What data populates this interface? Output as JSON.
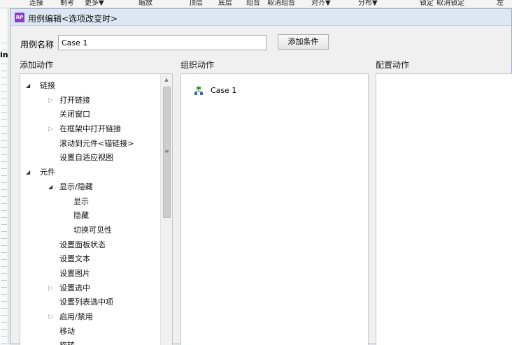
{
  "app_toolbar": {
    "items": [
      "连接",
      "制考",
      "更多▼",
      "缩放",
      "顶层",
      "底层",
      "组合",
      "取消组合",
      "对齐▼",
      "分布▼",
      "锁定",
      "取消锁定",
      "左"
    ]
  },
  "app_left": {
    "label": "in"
  },
  "dialog": {
    "logo": "RP",
    "title": "用例编辑<选项改变时>",
    "name_label": "用例名称",
    "name_value": "Case 1",
    "add_condition_label": "添加条件",
    "add_action_header": "添加动作",
    "organize_header": "组织动作",
    "config_header": "配置动作",
    "organize_case_label": "Case 1"
  },
  "tree": [
    {
      "label": "链接",
      "level": 0,
      "arrow": "open"
    },
    {
      "label": "打开链接",
      "level": 1,
      "arrow": "closed"
    },
    {
      "label": "关闭窗口",
      "level": 1,
      "arrow": "none"
    },
    {
      "label": "在框架中打开链接",
      "level": 1,
      "arrow": "closed"
    },
    {
      "label": "滚动到元件<锚链接>",
      "level": 1,
      "arrow": "none"
    },
    {
      "label": "设置自适应视图",
      "level": 1,
      "arrow": "none"
    },
    {
      "label": "元件",
      "level": 0,
      "arrow": "open"
    },
    {
      "label": "显示/隐藏",
      "level": 1,
      "arrow": "open"
    },
    {
      "label": "显示",
      "level": 2,
      "arrow": "none"
    },
    {
      "label": "隐藏",
      "level": 2,
      "arrow": "none"
    },
    {
      "label": "切换可见性",
      "level": 2,
      "arrow": "none"
    },
    {
      "label": "设置面板状态",
      "level": 1,
      "arrow": "none"
    },
    {
      "label": "设置文本",
      "level": 1,
      "arrow": "none"
    },
    {
      "label": "设置图片",
      "level": 1,
      "arrow": "none"
    },
    {
      "label": "设置选中",
      "level": 1,
      "arrow": "closed"
    },
    {
      "label": "设置列表选中项",
      "level": 1,
      "arrow": "none"
    },
    {
      "label": "启用/禁用",
      "level": 1,
      "arrow": "closed"
    },
    {
      "label": "移动",
      "level": 1,
      "arrow": "none"
    },
    {
      "label": "旋转",
      "level": 1,
      "arrow": "none"
    }
  ]
}
